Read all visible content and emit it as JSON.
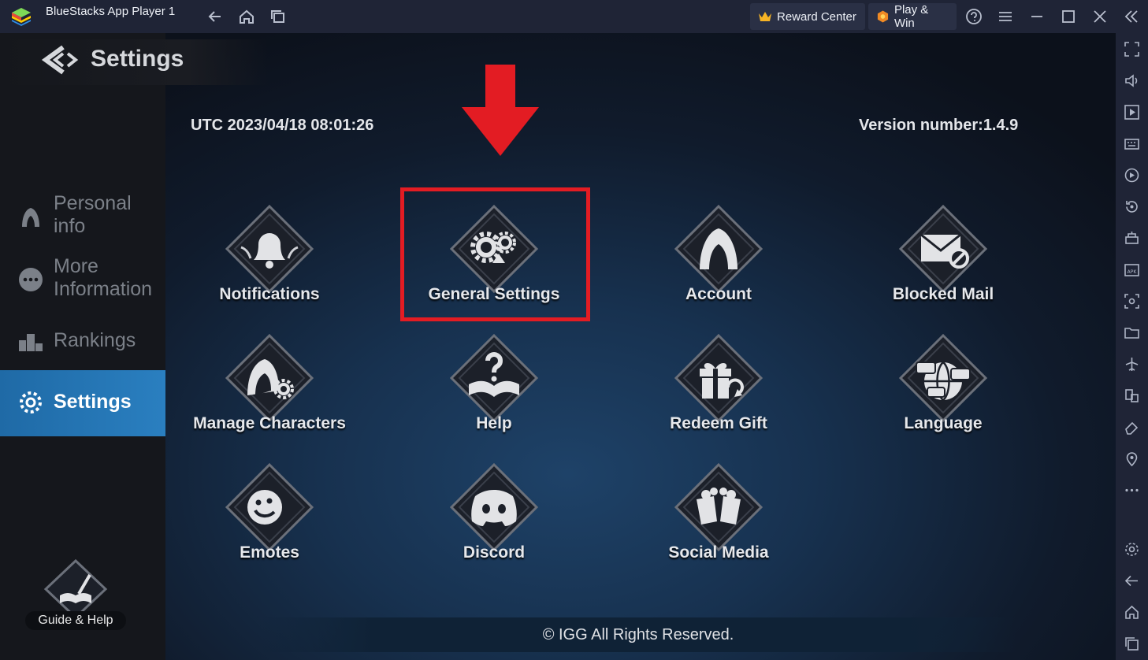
{
  "window": {
    "app_title": "BlueStacks App Player 1",
    "reward_center_label": "Reward Center",
    "play_win_label": "Play & Win"
  },
  "game": {
    "header_title": "Settings",
    "utc_time": "UTC 2023/04/18 08:01:26",
    "version": "Version number:1.4.9",
    "sidebar": [
      {
        "label": "Personal info",
        "icon": "hooded-figure-icon"
      },
      {
        "label": "More Information",
        "icon": "more-dots-icon"
      },
      {
        "label": "Rankings",
        "icon": "podium-icon"
      },
      {
        "label": "Settings",
        "icon": "gear-icon",
        "active": true
      }
    ],
    "tiles": [
      {
        "label": "Notifications",
        "icon": "bell-icon"
      },
      {
        "label": "General Settings",
        "icon": "gears-icon"
      },
      {
        "label": "Account",
        "icon": "hooded-figure-icon"
      },
      {
        "label": "Blocked Mail",
        "icon": "blocked-mail-icon"
      },
      {
        "label": "Manage Characters",
        "icon": "character-gear-icon"
      },
      {
        "label": "Help",
        "icon": "question-book-icon"
      },
      {
        "label": "Redeem Gift",
        "icon": "gift-icon"
      },
      {
        "label": "Language",
        "icon": "globe-chat-icon"
      },
      {
        "label": "Emotes",
        "icon": "emote-face-icon"
      },
      {
        "label": "Discord",
        "icon": "discord-icon"
      },
      {
        "label": "Social Media",
        "icon": "cheers-icon"
      }
    ],
    "guide_label": "Guide & Help",
    "footer": "© IGG All Rights Reserved."
  },
  "colors": {
    "highlight": "#e31c23",
    "sidebar_active": "#2a7fc0",
    "titlebar": "#1f2436"
  }
}
